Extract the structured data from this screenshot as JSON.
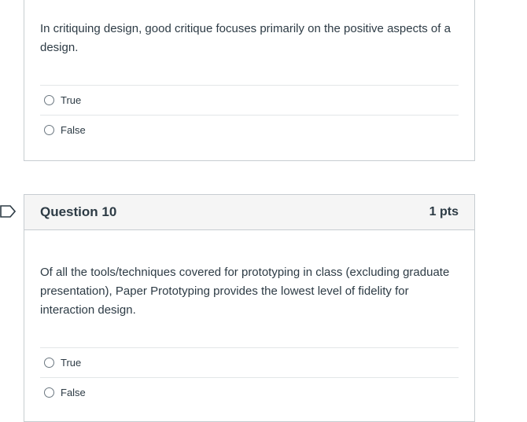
{
  "questions": [
    {
      "text": "In critiquing design, good critique focuses primarily on the positive aspects of a design.",
      "answers": [
        "True",
        "False"
      ]
    },
    {
      "title": "Question 10",
      "points": "1 pts",
      "text": "Of all the tools/techniques covered for prototyping in class (excluding graduate presentation), Paper Prototyping provides the lowest level of fidelity for interaction design.",
      "answers": [
        "True",
        "False"
      ]
    }
  ],
  "icons": {
    "flag": "bookmark-flag-icon",
    "radio": "radio-unselected-icon"
  },
  "colors": {
    "text": "#2d3b45",
    "border": "#c7cdd1",
    "header_bg": "#f5f5f5",
    "flag_stroke": "#2d3b45"
  }
}
